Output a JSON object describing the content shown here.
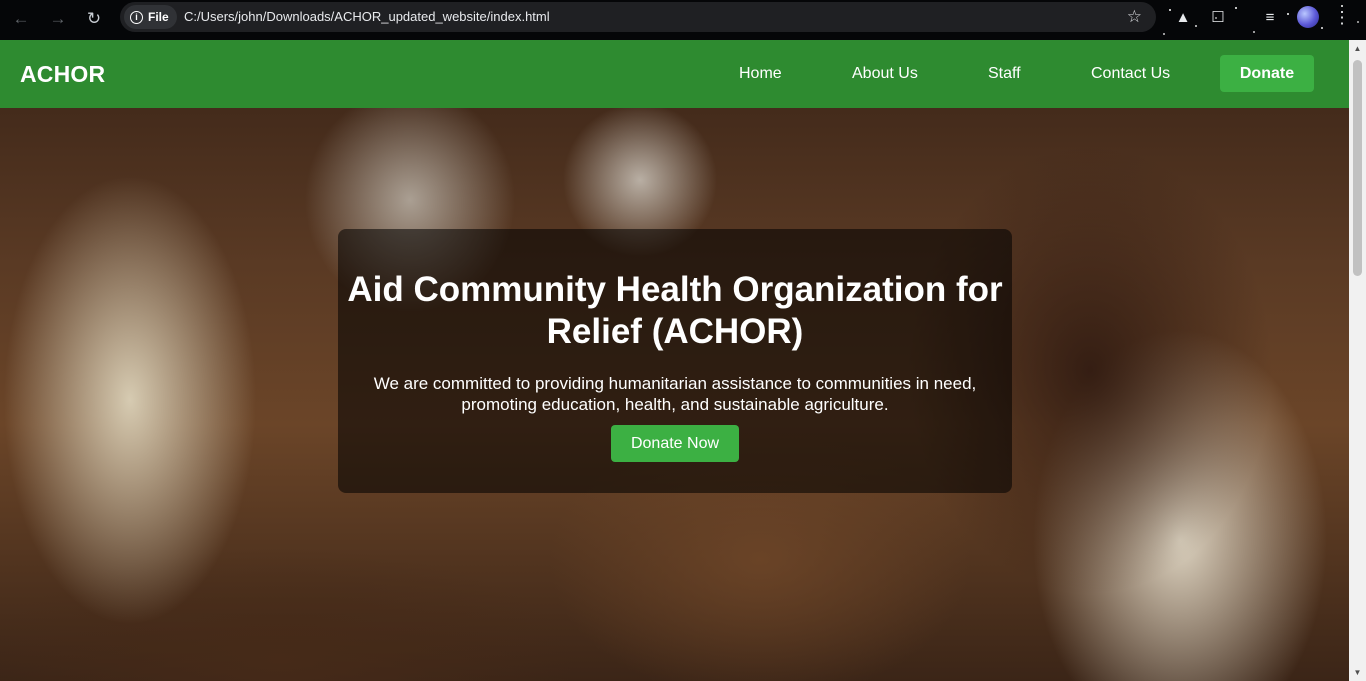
{
  "browser": {
    "site_label": "File",
    "url": "C:/Users/john/Downloads/ACHOR_updated_website/index.html",
    "icons": [
      "back-icon",
      "forward-icon",
      "reload-icon",
      "info-icon",
      "bookmark-star-icon",
      "extension-triangle-icon",
      "extension-puzzle-icon",
      "reading-list-icon",
      "profile-avatar-icon",
      "kebab-menu-icon"
    ]
  },
  "navbar": {
    "logo": "ACHOR",
    "links": [
      "Home",
      "About Us",
      "Staff",
      "Contact Us"
    ],
    "donate_label": "Donate",
    "background_color": "#2e8b30",
    "button_color": "#3cb043"
  },
  "hero": {
    "title": "Aid Community Health Organization for Relief (ACHOR)",
    "subtitle": "We are committed to providing humanitarian assistance to communities in need, promoting education, health, and sustainable agriculture.",
    "cta_label": "Donate Now"
  }
}
